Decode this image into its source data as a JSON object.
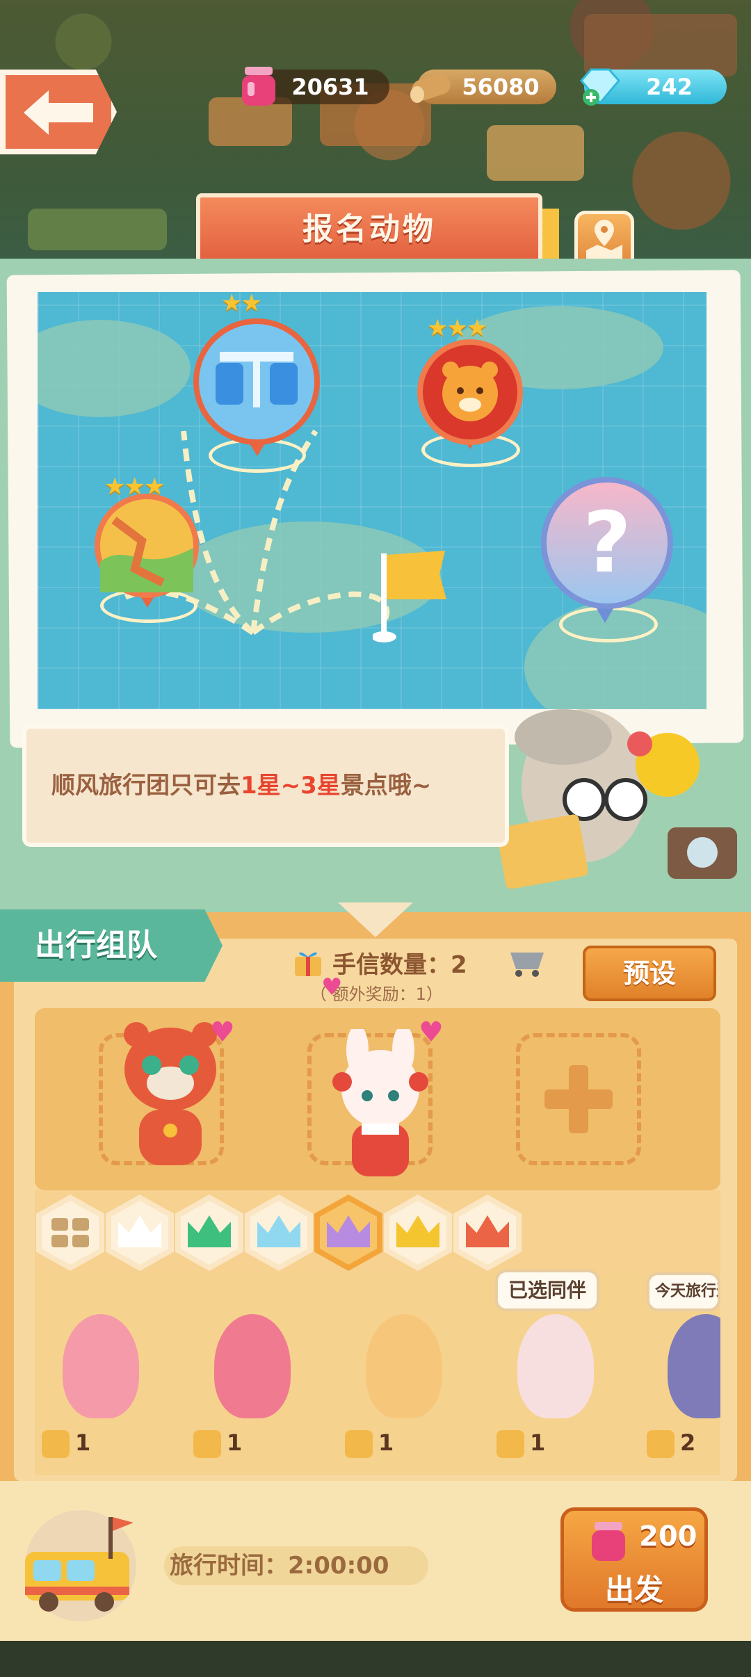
{
  "currencies": {
    "jam": {
      "value": "20631",
      "icon": "jam-jar-icon",
      "color": "#e8417a"
    },
    "wood": {
      "value": "56080",
      "icon": "wood-log-icon",
      "color": "#c58d4b"
    },
    "gem": {
      "value": "242",
      "icon": "gem-icon",
      "color": "#4fd0ea"
    }
  },
  "header": {
    "title": "报名动物"
  },
  "map": {
    "destinations": [
      {
        "name": "bridge",
        "stars": 2
      },
      {
        "name": "tiger",
        "stars": 3
      },
      {
        "name": "great-wall",
        "stars": 3
      },
      {
        "name": "unknown",
        "mark": "?"
      }
    ]
  },
  "tip": {
    "prefix": "顺风旅行团只可去",
    "range": "1星~3星",
    "suffix": "景点哦~"
  },
  "team": {
    "tab_label": "出行组队",
    "letters_label": "手信数量：2",
    "bonus_label": "（  额外奖励：1）",
    "preset_label": "预设"
  },
  "filters": [
    {
      "name": "all",
      "color": "#c9a36d"
    },
    {
      "name": "white",
      "color": "#ffffff"
    },
    {
      "name": "green",
      "color": "#3fbf7d"
    },
    {
      "name": "blue",
      "color": "#8fd8f0"
    },
    {
      "name": "purple",
      "color": "#b78be0",
      "selected": true
    },
    {
      "name": "gold",
      "color": "#f4c52f"
    },
    {
      "name": "red",
      "color": "#ea6445"
    }
  ],
  "roster": [
    {
      "count": "1",
      "color": "#f59aa8"
    },
    {
      "count": "1",
      "color": "#f07a8f"
    },
    {
      "count": "1",
      "color": "#f6c77a"
    },
    {
      "count": "1",
      "color": "#f7dfe0",
      "tag": "已选同伴"
    },
    {
      "count": "2",
      "color": "#7f7bb8",
      "tag": "今天旅行过"
    }
  ],
  "footer": {
    "time_label": "旅行时间：2:00:00",
    "cost": "200",
    "go_label": "出发"
  }
}
